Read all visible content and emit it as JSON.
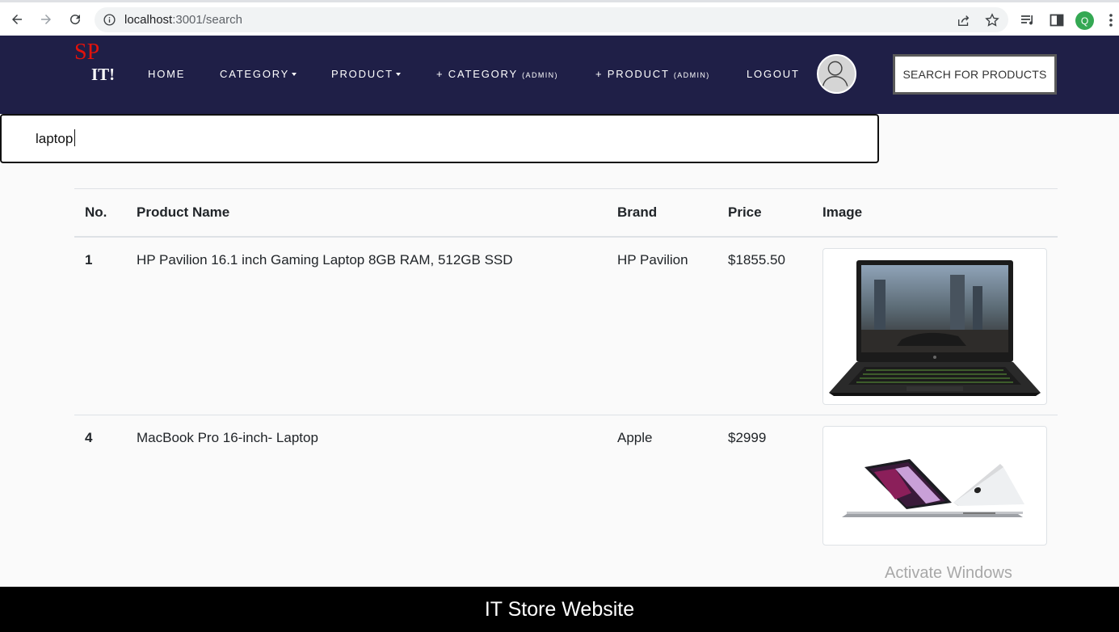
{
  "browser": {
    "url_host": "localhost",
    "url_path": ":3001/search",
    "profile_initial": "Q"
  },
  "nav": {
    "logo_top": "SP",
    "logo_bottom": "IT!",
    "home": "HOME",
    "category": "CATEGORY",
    "product": "PRODUCT",
    "add_category": "+ CATEGORY",
    "add_category_tag": "(ADMIN)",
    "add_product": "+ PRODUCT",
    "add_product_tag": "(ADMIN)",
    "logout": "LOGOUT",
    "search_button": "SEARCH FOR PRODUCTS"
  },
  "search": {
    "value": "laptop"
  },
  "table": {
    "headers": [
      "No.",
      "Product Name",
      "Brand",
      "Price",
      "Image"
    ],
    "rows": [
      {
        "no": "1",
        "name": "HP Pavilion 16.1 inch Gaming Laptop 8GB RAM, 512GB SSD",
        "brand": "HP Pavilion",
        "price": "$1855.50",
        "image": "hp-gaming-laptop-image"
      },
      {
        "no": "4",
        "name": "MacBook Pro 16-inch- Laptop",
        "brand": "Apple",
        "price": "$2999",
        "image": "macbook-pro-image"
      }
    ]
  },
  "watermark": "Activate Windows",
  "footer": "IT Store Website"
}
